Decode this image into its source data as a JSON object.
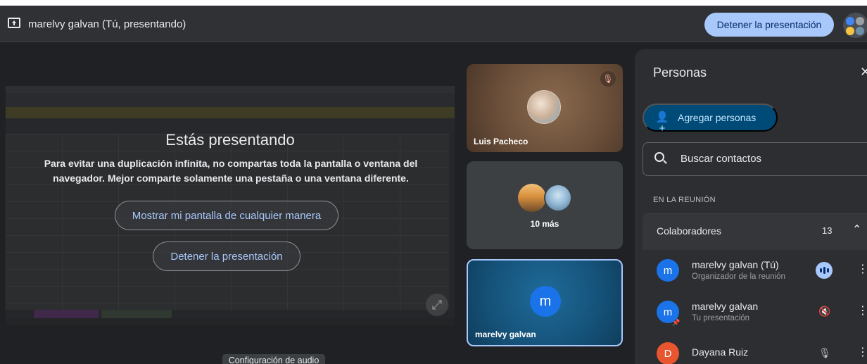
{
  "topbar": {
    "presenter_label": "marelvy galvan (Tú, presentando)",
    "stop_button": "Detener la presentación"
  },
  "presenting": {
    "title": "Estás presentando",
    "message": "Para evitar una duplicación infinita, no compartas toda la pantalla o ventana del navegador. Mejor comparte solamente una pestaña o una ventana diferente.",
    "show_anyway_button": "Mostrar mi pantalla de cualquier manera",
    "stop_button": "Detener la presentación"
  },
  "tooltip": {
    "audio": "Configuración de audio"
  },
  "tiles": [
    {
      "name": "Luis Pacheco"
    },
    {
      "name": "10 más"
    },
    {
      "name": "marelvy galvan",
      "initial": "m"
    }
  ],
  "panel": {
    "title": "Personas",
    "add_button": "Agregar personas",
    "search_placeholder": "Buscar contactos",
    "section_label": "EN LA REUNIÓN",
    "group": {
      "label": "Colaboradores",
      "count": "13"
    },
    "people": [
      {
        "initial": "m",
        "name": "marelvy galvan (Tú)",
        "subtitle": "Organizador de la reunión",
        "avatar_color": "#1a73e8"
      },
      {
        "initial": "m",
        "name": "marelvy galvan",
        "subtitle": "Tu presentación",
        "avatar_color": "#1a73e8"
      },
      {
        "initial": "D",
        "name": "Dayana Ruiz",
        "subtitle": "",
        "avatar_color": "#e8552f"
      }
    ]
  },
  "colors": {
    "accent": "#a8c7fa",
    "panel_bg": "#2d2e31",
    "app_bg": "#202124"
  }
}
